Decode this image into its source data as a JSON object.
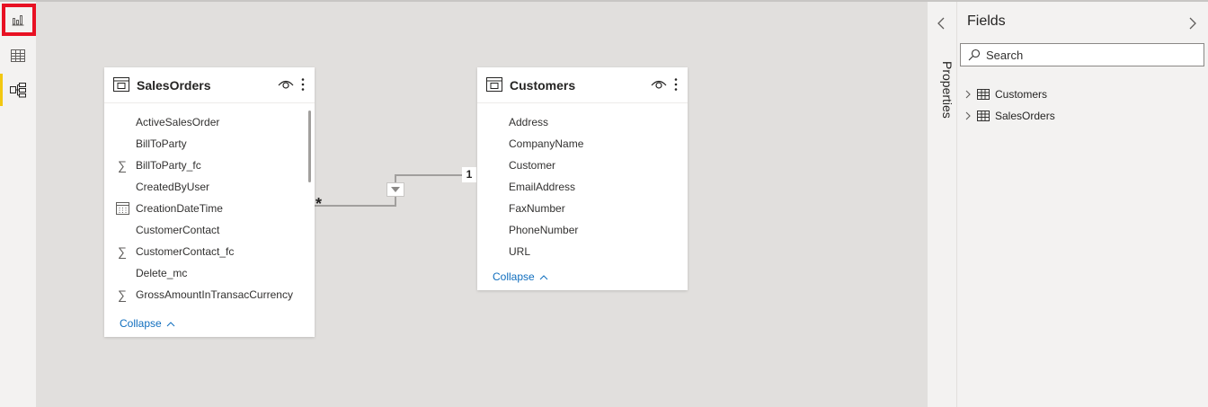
{
  "nav": {
    "items": [
      {
        "name": "Report view",
        "icon": "bar-chart-icon",
        "highlighted": true
      },
      {
        "name": "Data view",
        "icon": "table-grid-icon"
      },
      {
        "name": "Model view",
        "icon": "model-diagram-icon",
        "active": true
      }
    ]
  },
  "tables": [
    {
      "name": "SalesOrders",
      "fields": [
        {
          "label": "ActiveSalesOrder",
          "icon": ""
        },
        {
          "label": "BillToParty",
          "icon": ""
        },
        {
          "label": "BillToParty_fc",
          "icon": "sigma-icon"
        },
        {
          "label": "CreatedByUser",
          "icon": ""
        },
        {
          "label": "CreationDateTime",
          "icon": "calendar-icon"
        },
        {
          "label": "CustomerContact",
          "icon": ""
        },
        {
          "label": "CustomerContact_fc",
          "icon": "sigma-icon"
        },
        {
          "label": "Delete_mc",
          "icon": ""
        },
        {
          "label": "GrossAmountInTransacCurrency",
          "icon": "sigma-icon"
        }
      ],
      "collapse_label": "Collapse"
    },
    {
      "name": "Customers",
      "fields": [
        {
          "label": "Address",
          "icon": ""
        },
        {
          "label": "CompanyName",
          "icon": ""
        },
        {
          "label": "Customer",
          "icon": ""
        },
        {
          "label": "EmailAddress",
          "icon": ""
        },
        {
          "label": "FaxNumber",
          "icon": ""
        },
        {
          "label": "PhoneNumber",
          "icon": ""
        },
        {
          "label": "URL",
          "icon": ""
        }
      ],
      "collapse_label": "Collapse"
    }
  ],
  "relationship": {
    "from": "SalesOrders",
    "to": "Customers",
    "from_cardinality": "*",
    "to_cardinality": "1",
    "filter_direction": "single"
  },
  "properties_pane": {
    "label": "Properties"
  },
  "fields_pane": {
    "title": "Fields",
    "search_placeholder": "Search",
    "search_value": "",
    "items": [
      {
        "label": "Customers"
      },
      {
        "label": "SalesOrders"
      }
    ]
  },
  "colors": {
    "accent_active": "#f2c811",
    "highlight_box": "#e81123",
    "link": "#106ebe"
  }
}
